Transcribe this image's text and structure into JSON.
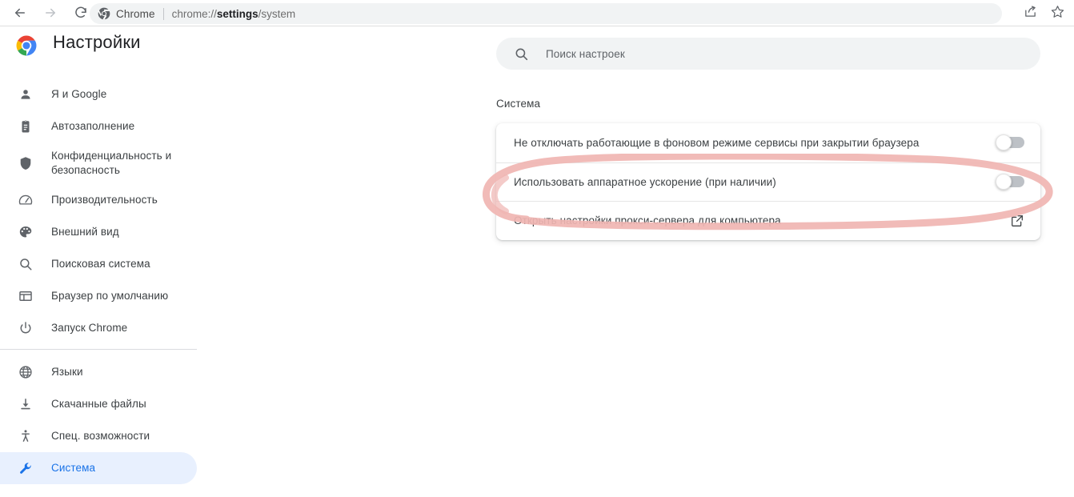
{
  "browser": {
    "back_icon": "back-arrow-icon",
    "forward_icon": "forward-arrow-icon",
    "reload_icon": "reload-icon",
    "omnibox": {
      "chrome_icon": "chrome-icon",
      "app_label": "Chrome",
      "url_scheme": "chrome://",
      "url_bold": "settings",
      "url_tail": "/system",
      "full_url": "chrome://settings/system"
    },
    "share_icon": "share-icon",
    "bookmark_icon": "star-icon"
  },
  "header": {
    "logo_icon": "chrome-logo-icon",
    "title": "Настройки"
  },
  "sidebar": {
    "groups": [
      {
        "items": [
          {
            "label": "Я и Google",
            "icon": "person-icon",
            "selected": false
          },
          {
            "label": "Автозаполнение",
            "icon": "clipboard-icon",
            "selected": false
          },
          {
            "label": "Конфиденциальность и безопасность",
            "icon": "shield-icon",
            "selected": false
          },
          {
            "label": "Производительность",
            "icon": "speedometer-icon",
            "selected": false
          },
          {
            "label": "Внешний вид",
            "icon": "palette-icon",
            "selected": false
          },
          {
            "label": "Поисковая система",
            "icon": "search-icon",
            "selected": false
          },
          {
            "label": "Браузер по умолчанию",
            "icon": "window-icon",
            "selected": false
          },
          {
            "label": "Запуск Chrome",
            "icon": "power-icon",
            "selected": false
          }
        ]
      },
      {
        "items": [
          {
            "label": "Языки",
            "icon": "globe-icon",
            "selected": false
          },
          {
            "label": "Скачанные файлы",
            "icon": "download-icon",
            "selected": false
          },
          {
            "label": "Спец. возможности",
            "icon": "accessibility-icon",
            "selected": false
          },
          {
            "label": "Система",
            "icon": "wrench-icon",
            "selected": true
          }
        ]
      }
    ]
  },
  "search": {
    "icon": "search-icon",
    "placeholder": "Поиск настроек",
    "value": ""
  },
  "main": {
    "section_title": "Система",
    "rows": [
      {
        "label": "Не отключать работающие в фоновом режиме сервисы при закрытии браузера",
        "control": "toggle",
        "state": "off"
      },
      {
        "label": "Использовать аппаратное ускорение (при наличии)",
        "control": "toggle",
        "state": "off",
        "annotated": true
      },
      {
        "label": "Открыть настройки прокси-сервера для компьютера",
        "control": "external-link",
        "icon": "external-link-icon"
      }
    ]
  },
  "annotation": {
    "shape": "ellipse",
    "color": "#f0b5b2",
    "targets_row": "Использовать аппаратное ускорение (при наличии)"
  },
  "colors": {
    "accent": "#1a73e8",
    "selected_bg": "#e8f0fe",
    "text": "#3c4043",
    "muted": "#5f6368",
    "chip_bg": "#f1f3f4",
    "annotation": "#f0b5b2"
  }
}
